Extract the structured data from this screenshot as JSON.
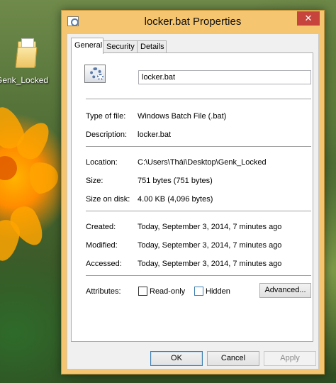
{
  "desktop": {
    "icon_label": "Genk_Locked",
    "icon_name": "folder-icon"
  },
  "window": {
    "title": "locker.bat Properties",
    "close_glyph": "✕"
  },
  "tabs": [
    {
      "label": "General",
      "active": true
    },
    {
      "label": "Security",
      "active": false
    },
    {
      "label": "Details",
      "active": false
    }
  ],
  "general": {
    "file_name": "locker.bat",
    "file_icon": "batch-file-gear-icon",
    "fields": {
      "type_of_file": {
        "label": "Type of file:",
        "value": "Windows Batch File (.bat)"
      },
      "description": {
        "label": "Description:",
        "value": "locker.bat"
      },
      "location": {
        "label": "Location:",
        "value": "C:\\Users\\Thái\\Desktop\\Genk_Locked"
      },
      "size": {
        "label": "Size:",
        "value": "751 bytes (751 bytes)"
      },
      "size_on_disk": {
        "label": "Size on disk:",
        "value": "4.00 KB (4,096 bytes)"
      },
      "created": {
        "label": "Created:",
        "value": "Today, September 3, 2014, 7 minutes ago"
      },
      "modified": {
        "label": "Modified:",
        "value": "Today, September 3, 2014, 7 minutes ago"
      },
      "accessed": {
        "label": "Accessed:",
        "value": "Today, September 3, 2014, 7 minutes ago"
      }
    },
    "attributes": {
      "label": "Attributes:",
      "read_only": {
        "label": "Read-only",
        "checked": false
      },
      "hidden": {
        "label": "Hidden",
        "checked": false
      },
      "advanced_label": "Advanced..."
    }
  },
  "buttons": {
    "ok": "OK",
    "cancel": "Cancel",
    "apply": "Apply"
  },
  "colors": {
    "title_bar": "#f5c56f",
    "close_button": "#c7443d",
    "focus_border": "#3c7fb1"
  }
}
